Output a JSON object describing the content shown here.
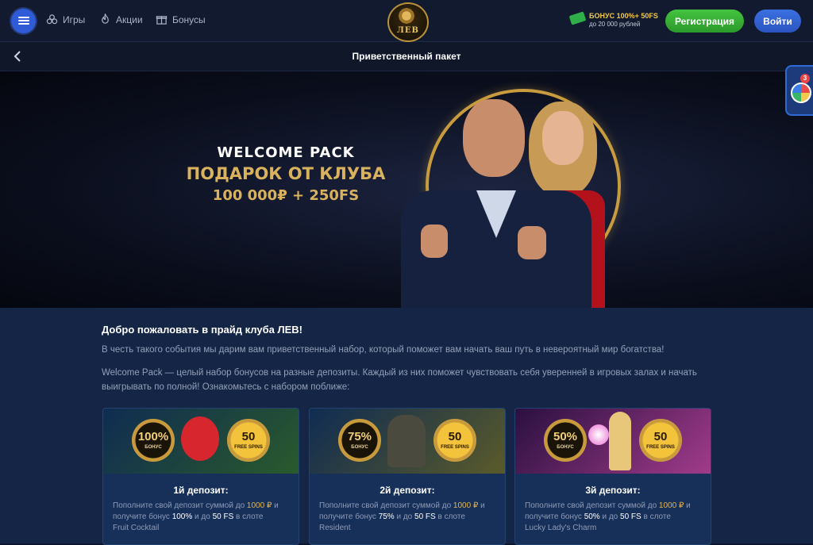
{
  "header": {
    "nav": [
      {
        "label": "Игры",
        "icon": "games-icon"
      },
      {
        "label": "Акции",
        "icon": "flame-icon"
      },
      {
        "label": "Бонусы",
        "icon": "gift-icon"
      }
    ],
    "logo_text": "ЛЕВ",
    "bonus_line1": "БОНУС 100%+ 50FS",
    "bonus_line2": "до 20 000 рублей",
    "register_label": "Регистрация",
    "login_label": "Войти"
  },
  "subheader": {
    "title": "Приветственный пакет"
  },
  "banner": {
    "line1": "WELCOME PACK",
    "line2": "ПОДАРОК ОТ КЛУБА",
    "line3": "100 000₽ + 250FS"
  },
  "intro": {
    "heading": "Добро пожаловать в прайд клуба ЛЕВ!",
    "p1": "В честь такого события мы дарим вам приветственный набор, который поможет вам начать ваш путь в невероятный мир богатства!",
    "p2": "Welcome Pack — целый набор бонусов на разные депозиты. Каждый из них поможет чувствовать себя уверенней в игровых залах и начать выигрывать по полной! Ознакомьтесь с набором поближе:"
  },
  "cards": [
    {
      "title": "1й депозит:",
      "badge_percent": "100%",
      "badge_percent_sub": "БОНУС",
      "badge_fs": "50",
      "badge_fs_sub": "FREE SPINS",
      "t1": "Пополните свой депозит суммой до ",
      "amount": "1000 ₽",
      "t2": " и получите бонус ",
      "percent": "100%",
      "t3": " и до ",
      "fs": "50 FS",
      "t4": " в слоте",
      "slot": "Fruit Cocktail",
      "bg1": "#0f2c52",
      "bg2": "#2a5a2c"
    },
    {
      "title": "2й депозит:",
      "badge_percent": "75%",
      "badge_percent_sub": "БОНУС",
      "badge_fs": "50",
      "badge_fs_sub": "FREE SPINS",
      "t1": "Пополните свой депозит суммой до ",
      "amount": "1000 ₽",
      "t2": " и получите бонус ",
      "percent": "75%",
      "t3": " и до ",
      "fs": "50 FS",
      "t4": " в слоте",
      "slot": "Resident",
      "bg1": "#0f2c52",
      "bg2": "#5a5a2a"
    },
    {
      "title": "3й депозит:",
      "badge_percent": "50%",
      "badge_percent_sub": "БОНУС",
      "badge_fs": "50",
      "badge_fs_sub": "FREE SPINS",
      "t1": "Пополните свой депозит суммой до ",
      "amount": "1000 ₽",
      "t2": " и получите бонус ",
      "percent": "50%",
      "t3": " и до ",
      "fs": "50 FS",
      "t4": " в слоте",
      "slot": "Lucky Lady's Charm",
      "bg1": "#2a1040",
      "bg2": "#a13b8a"
    }
  ],
  "side_widget": {
    "count": "3"
  }
}
